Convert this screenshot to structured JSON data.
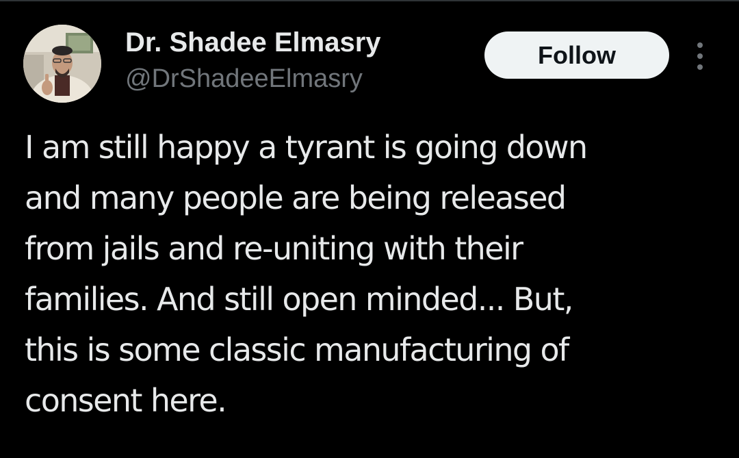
{
  "tweet": {
    "author": {
      "display_name": "Dr. Shadee Elmasry",
      "handle": "@DrShadeeElmasry",
      "avatar": "user-avatar-photo"
    },
    "follow_label": "Follow",
    "more_icon": "more-vertical-icon",
    "text": "I am still happy a tyrant is going down\nand many people are being released\nfrom jails and re-uniting with their\nfamilies. And still open minded... But,\nthis is some classic manufacturing of\nconsent here."
  },
  "colors": {
    "background": "#000000",
    "primary_text": "#e7e9ea",
    "secondary_text": "#71767b",
    "follow_button_bg": "#eff3f4",
    "follow_button_text": "#0f1419"
  }
}
